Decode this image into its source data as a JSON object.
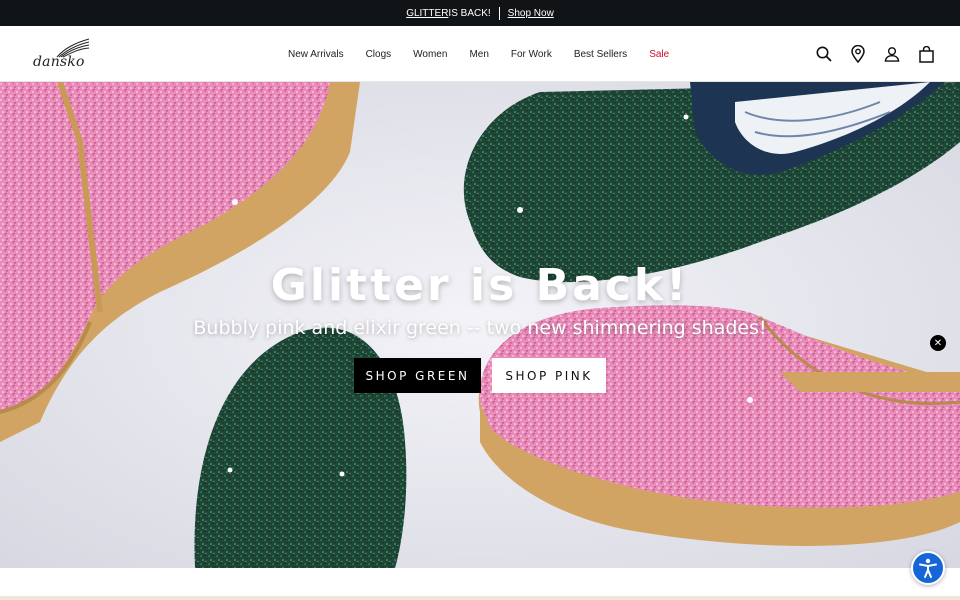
{
  "announcement": {
    "highlight": "GLITTER",
    "text": " IS BACK!",
    "link": "Shop Now"
  },
  "header": {
    "logo_text": "dansko",
    "nav": [
      "New Arrivals",
      "Clogs",
      "Women",
      "Men",
      "For Work",
      "Best Sellers",
      "Sale"
    ],
    "icons": [
      "search-icon",
      "location-icon",
      "account-icon",
      "cart-icon"
    ],
    "sale_color": "#c8102e"
  },
  "hero": {
    "title": "Glitter is Back!",
    "subtitle": "Bubbly pink and elixir green -- two new shimmering shades!",
    "buttons": {
      "green": "SHOP GREEN",
      "pink": "SHOP PINK"
    },
    "colors": {
      "pink": "#e888b8",
      "green": "#1f4a3a",
      "sole": "#d2a463",
      "background": "#e8e8ef"
    }
  },
  "close_label": "✕",
  "accessibility_label": "accessibility"
}
